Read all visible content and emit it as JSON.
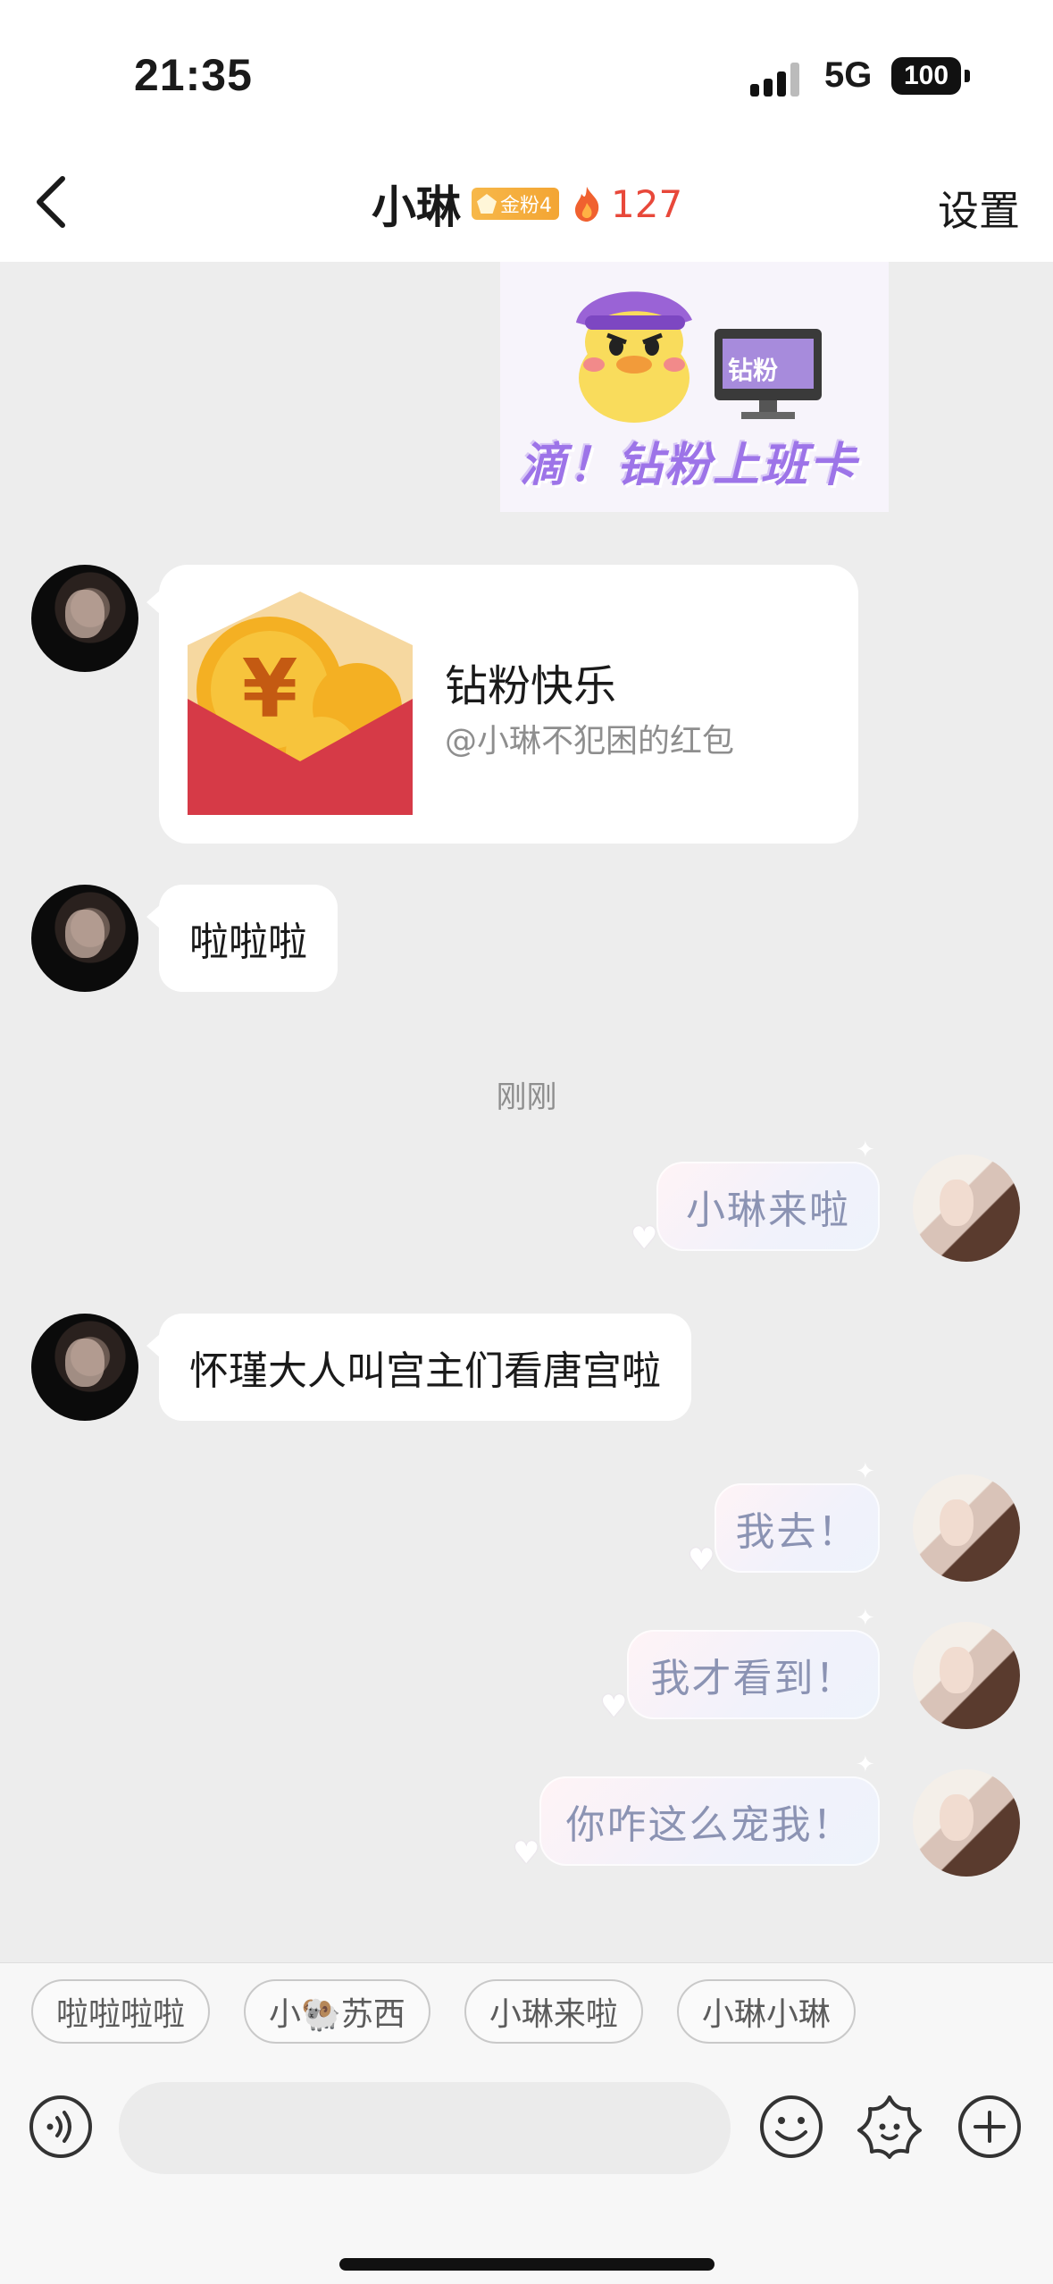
{
  "status_bar": {
    "time": "21:35",
    "network": "5G",
    "battery": "100"
  },
  "header": {
    "name": "小琳",
    "fan_badge": "金粉4",
    "fire_count": "127",
    "settings": "设置"
  },
  "sticker": {
    "label": "钻粉",
    "caption": "滴！钻粉上班卡"
  },
  "messages": [
    {
      "side": "left",
      "type": "red_packet",
      "title": "钻粉快乐",
      "subtitle": "@小琳不犯困的红包"
    },
    {
      "side": "left",
      "type": "text",
      "text": "啦啦啦"
    },
    {
      "type": "timestamp",
      "text": "刚刚"
    },
    {
      "side": "right",
      "type": "text",
      "text": "小琳来啦"
    },
    {
      "side": "left",
      "type": "text",
      "text": "怀瑾大人叫宫主们看唐宫啦"
    },
    {
      "side": "right",
      "type": "text",
      "text": "我去！"
    },
    {
      "side": "right",
      "type": "text",
      "text": "我才看到！"
    },
    {
      "side": "right",
      "type": "text",
      "text": "你咋这么宠我！"
    }
  ],
  "quick_replies": [
    "啦啦啦啦",
    "小🐏苏西",
    "小琳来啦",
    "小琳小琳"
  ],
  "input": {
    "placeholder": ""
  },
  "colors": {
    "accent_red": "#e8483a",
    "badge_gold": "#f3a533",
    "bubble_text_right": "#8b93b3"
  }
}
